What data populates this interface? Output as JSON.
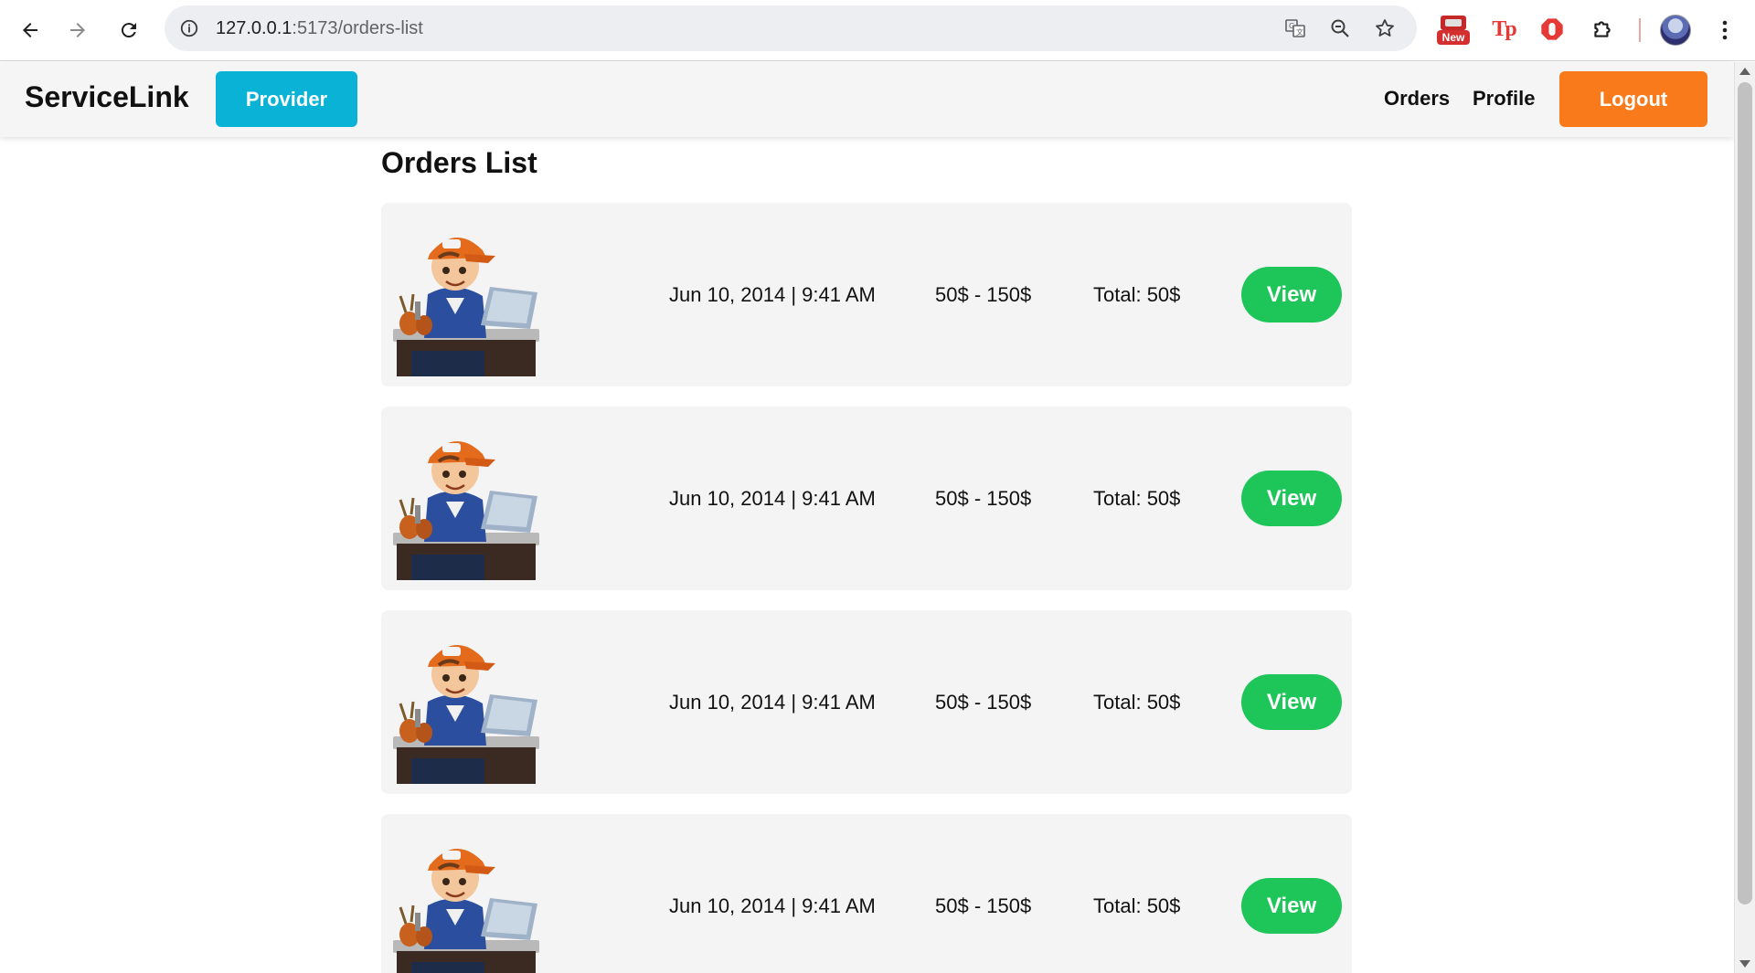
{
  "browser": {
    "url_host": "127.0.0.1",
    "url_path": ":5173/orders-list",
    "icons": [
      "back-arrow-icon",
      "forward-arrow-icon",
      "reload-icon",
      "site-info-icon",
      "translate-icon",
      "zoom-icon",
      "bookmark-star-icon",
      "extensions-puzzle-icon",
      "kebab-menu-icon"
    ],
    "ext_new_badge": "New",
    "ext_tp_label": "Tp"
  },
  "header": {
    "brand": "ServiceLink",
    "role_button": "Provider",
    "nav": {
      "orders": "Orders",
      "profile": "Profile"
    },
    "logout": "Logout",
    "colors": {
      "provider": "#0ab3d6",
      "logout": "#f87a1a"
    }
  },
  "main": {
    "title": "Orders List",
    "orders": [
      {
        "date": "Jun 10, 2014 | 9:41 AM",
        "range": "50$ - 150$",
        "total": "Total: 50$",
        "action": "View"
      },
      {
        "date": "Jun 10, 2014 | 9:41 AM",
        "range": "50$ - 150$",
        "total": "Total: 50$",
        "action": "View"
      },
      {
        "date": "Jun 10, 2014 | 9:41 AM",
        "range": "50$ - 150$",
        "total": "Total: 50$",
        "action": "View"
      },
      {
        "date": "Jun 10, 2014 | 9:41 AM",
        "range": "50$ - 150$",
        "total": "Total: 50$",
        "action": "View"
      }
    ],
    "colors": {
      "view_button": "#1ec659"
    }
  }
}
